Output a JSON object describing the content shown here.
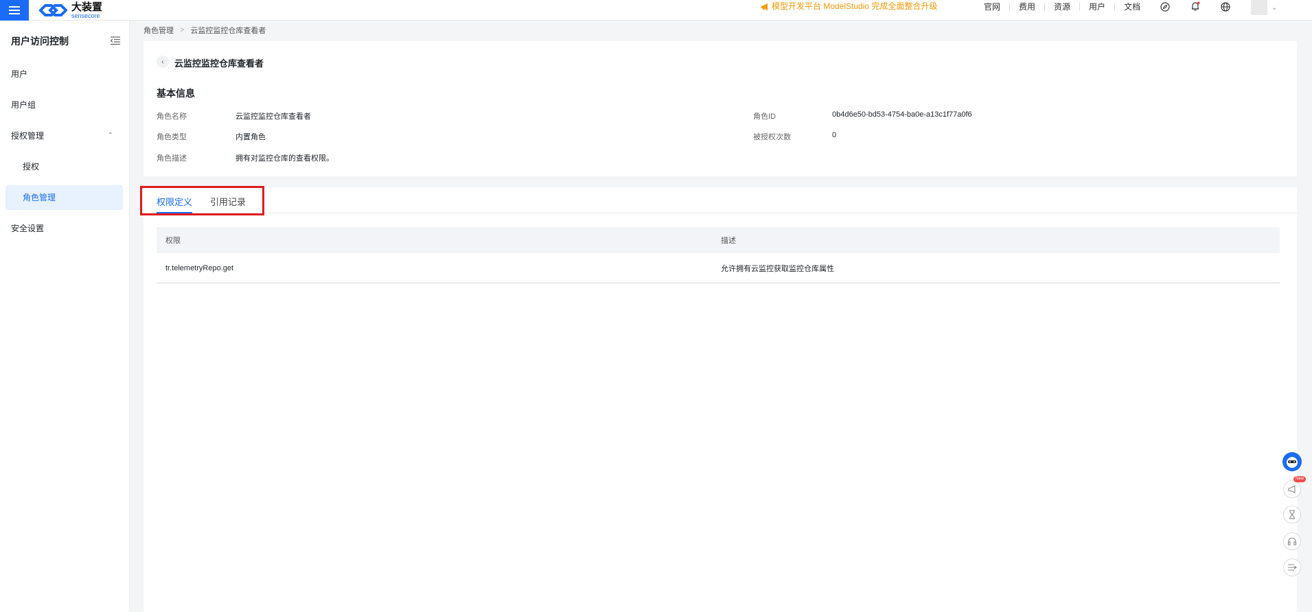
{
  "brand": {
    "name_cn": "大装置",
    "name_en": "sensecore",
    "accent_color": "#1a6cf6",
    "icon": "hamburger-menu-icon"
  },
  "promo": {
    "text": "模型开发平台 ModelStudio 完成全面整合升级",
    "color": "#f59a0b",
    "icon": "megaphone-icon"
  },
  "topnav": {
    "links": [
      "官网",
      "费用",
      "资源",
      "用户",
      "文档"
    ]
  },
  "topicons": [
    "compass-icon",
    "bell-icon",
    "globe-icon"
  ],
  "sidebar": {
    "title": "用户访问控制",
    "items": [
      {
        "label": "用户"
      },
      {
        "label": "用户组"
      },
      {
        "label": "授权管理"
      },
      {
        "label": "授权"
      },
      {
        "label": "角色管理"
      },
      {
        "label": "安全设置"
      }
    ]
  },
  "breadcrumb": [
    "角色管理",
    "云监控监控仓库查看者"
  ],
  "page": {
    "title": "云监控监控仓库查看者",
    "section_title": "基本信息",
    "fields": {
      "role_name_label": "角色名称",
      "role_name_value": "云监控监控仓库查看者",
      "role_type_label": "角色类型",
      "role_type_value": "内置角色",
      "role_desc_label": "角色描述",
      "role_desc_value": "拥有对监控仓库的查看权限。",
      "role_id_label": "角色ID",
      "role_id_value": "0b4d6e50-bd53-4754-ba0e-a13c1f77a0f6",
      "grant_count_label": "被授权次数",
      "grant_count_value": "0"
    }
  },
  "tabs": [
    {
      "label": "权限定义",
      "active": true
    },
    {
      "label": "引用记录",
      "active": false
    }
  ],
  "table": {
    "headers": [
      "权限",
      "描述"
    ],
    "rows": [
      [
        "tr.telemetryRepo.get",
        "允许拥有云监控获取监控仓库属性"
      ]
    ]
  },
  "float_widgets": {
    "badge": "New",
    "icons": [
      "assistant-bot-icon",
      "announcement-icon",
      "hourglass-icon",
      "headset-icon",
      "collapse-icon"
    ]
  },
  "highlight_color": "#e01b1b"
}
